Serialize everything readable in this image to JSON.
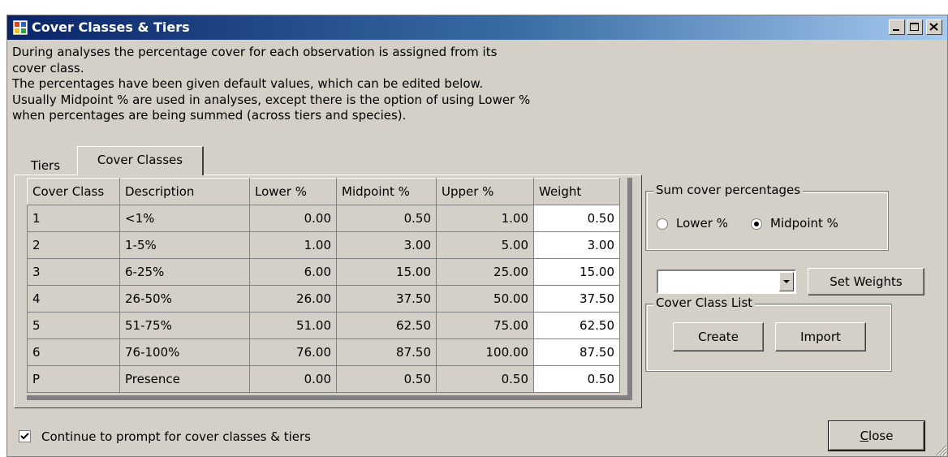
{
  "window": {
    "title": "Cover Classes & Tiers",
    "icons": [
      "app-icon",
      "minimize-icon",
      "maximize-icon",
      "close-icon"
    ]
  },
  "intro": {
    "line1": "During analyses the percentage cover for each observation is assigned from its",
    "line2": "cover class.",
    "line3": "The percentages have been given default values, which can be edited below.",
    "line4": "Usually Midpoint % are used in analyses, except there is the option of using Lower %",
    "line5": "when percentages are being summed (across tiers and species)."
  },
  "tabs": [
    {
      "label": "Tiers",
      "active": false
    },
    {
      "label": "Cover Classes",
      "active": true
    }
  ],
  "grid": {
    "columns": [
      "Cover Class",
      "Description",
      "Lower %",
      "Midpoint %",
      "Upper %",
      "Weight"
    ],
    "rows": [
      [
        "1",
        "<1%",
        "0.00",
        "0.50",
        "1.00",
        "0.50"
      ],
      [
        "2",
        "1-5%",
        "1.00",
        "3.00",
        "5.00",
        "3.00"
      ],
      [
        "3",
        "6-25%",
        "6.00",
        "15.00",
        "25.00",
        "15.00"
      ],
      [
        "4",
        "26-50%",
        "26.00",
        "37.50",
        "50.00",
        "37.50"
      ],
      [
        "5",
        "51-75%",
        "51.00",
        "62.50",
        "75.00",
        "62.50"
      ],
      [
        "6",
        "76-100%",
        "76.00",
        "87.50",
        "100.00",
        "87.50"
      ],
      [
        "P",
        "Presence",
        "0.00",
        "0.50",
        "0.50",
        "0.50"
      ]
    ]
  },
  "sum_cover": {
    "legend": "Sum cover percentages",
    "options": [
      {
        "label": "Lower %",
        "selected": false
      },
      {
        "label": "Midpoint %",
        "selected": true
      }
    ]
  },
  "weights": {
    "dropdown_value": "",
    "button": "Set Weights"
  },
  "cover_class_list": {
    "legend": "Cover Class List",
    "create": "Create",
    "import": "Import"
  },
  "footer": {
    "checkbox_label": "Continue to prompt for cover classes & tiers",
    "checkbox_checked": true,
    "close_first": "C",
    "close_rest": "lose"
  },
  "colors": {
    "face": "#d4d0c8",
    "title_start": "#0a246a",
    "title_end": "#a6caf0"
  }
}
